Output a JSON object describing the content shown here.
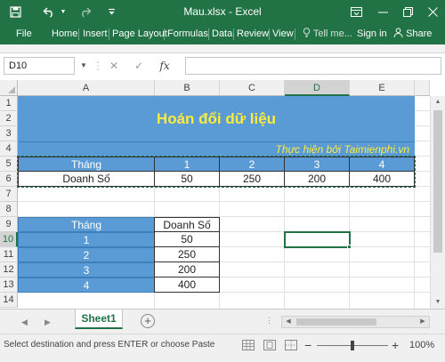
{
  "window": {
    "title": "Mau.xlsx - Excel",
    "accent": "#217346",
    "minimize_icon": "minimize-icon",
    "restore_icon": "restore-icon",
    "close_icon": "close-icon",
    "ribbon_display_icon": "ribbon-display-icon"
  },
  "quick_access": {
    "save_icon": "save-icon",
    "undo_icon": "undo-icon",
    "redo_icon": "redo-icon",
    "customize_icon": "customize-icon"
  },
  "ribbon": {
    "tabs": [
      "File",
      "Home",
      "Insert",
      "Page Layout",
      "Formulas",
      "Data",
      "Review",
      "View"
    ],
    "tell_me": "Tell me...",
    "sign_in": "Sign in",
    "share": "Share"
  },
  "formula_bar": {
    "name_box": "D10",
    "cancel_glyph": "✕",
    "enter_glyph": "✓",
    "fx_label": "fx",
    "formula": ""
  },
  "grid": {
    "columns": [
      "A",
      "B",
      "C",
      "D",
      "E"
    ],
    "rows": [
      "1",
      "2",
      "3",
      "4",
      "5",
      "6",
      "7",
      "8",
      "9",
      "10",
      "11",
      "12",
      "13",
      "14"
    ],
    "selected_column": "D",
    "selected_row": "10",
    "fill_color": "#5b9bd5",
    "title_color": "#ffeb3b"
  },
  "sheet": {
    "title": "Hoán đổi dữ liệu",
    "credit": "Thực hiện bởi Taimienphi.vn",
    "horizontal": {
      "header_label": "Tháng",
      "row_label": "Doanh Số",
      "months": [
        "1",
        "2",
        "3",
        "4"
      ],
      "values": [
        "50",
        "250",
        "200",
        "400"
      ]
    },
    "vertical": {
      "col1_header": "Tháng",
      "col2_header": "Doanh Số",
      "months": [
        "1",
        "2",
        "3",
        "4"
      ],
      "values": [
        "50",
        "250",
        "200",
        "400"
      ]
    }
  },
  "tabs": {
    "sheet_name": "Sheet1",
    "add_sheet": "+"
  },
  "status": {
    "message": "Select destination and press ENTER or choose Paste",
    "zoom_minus": "−",
    "zoom_plus": "+",
    "zoom_level": "100%"
  }
}
